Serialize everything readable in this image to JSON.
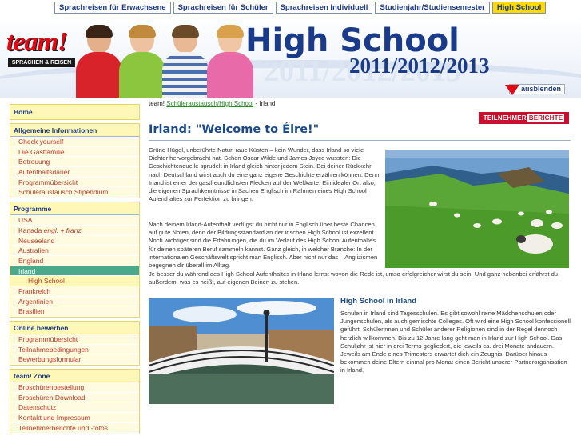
{
  "topnav": [
    {
      "label": "Sprachreisen für Erwachsene"
    },
    {
      "label": "Sprachreisen für Schüler"
    },
    {
      "label": "Sprachreisen Individuell"
    },
    {
      "label": "Studienjahr/Studiensemester"
    },
    {
      "label": "High School"
    }
  ],
  "header": {
    "logo_text": "team!",
    "logo_sub": "SPRACHEN & REISEN",
    "title": "High School",
    "years": "2011/2012/2013",
    "years_bg": "2011/2012/2013",
    "hide_label": "ausblenden"
  },
  "colors": {
    "nav_active": "#ffd900",
    "brand_blue": "#1a3a8a",
    "brand_red": "#e30613",
    "sidebar_bg": "#fff7b8",
    "active_item": "#4aa98a"
  },
  "sidebar": {
    "home": "Home",
    "general": {
      "title": "Allgemeine Informationen",
      "items": [
        "Check yourself",
        "Die Gastfamilie",
        "Betreuung",
        "Aufenthaltsdauer",
        "Programmübersicht",
        "Schüleraustausch Stipendium"
      ]
    },
    "programs": {
      "title": "Programme",
      "items": [
        {
          "label": "USA"
        },
        {
          "label": "Kanada",
          "note": "engl. + franz."
        },
        {
          "label": "Neuseeland"
        },
        {
          "label": "Australien"
        },
        {
          "label": "England"
        },
        {
          "label": "Irland"
        },
        {
          "label": "High School"
        },
        {
          "label": "Frankreich"
        },
        {
          "label": "Argentinien"
        },
        {
          "label": "Brasilien"
        }
      ]
    },
    "apply": {
      "title": "Online bewerben",
      "items": [
        "Programmübersicht",
        "Teilnahmebedingungen",
        "Bewerbungsformular"
      ]
    },
    "zone": {
      "title": "team! Zone",
      "items": [
        "Broschürenbestellung",
        "Broschüren Download",
        "Datenschutz",
        "Kontakt und Impressum",
        "Teilnehmerberichte und -fotos"
      ]
    }
  },
  "content": {
    "crumb_prefix": "team!",
    "crumb_link": "Schüleraustausch/High School",
    "crumb_suffix": "- Irland",
    "tn_label_1": "TEILNEHMER",
    "tn_label_2": "BERICHTE",
    "heading": "Irland: \"Welcome to Éire!\"",
    "para1": "Grüne Hügel, unberührte Natur, raue Küsten – kein Wunder, dass Irland so viele Dichter hervorgebracht hat. Schon Oscar Wilde und James Joyce wussten: Die Geschichtenquelle sprudelt in Irland gleich hinter jedem Stein. Bei deiner Rückkehr nach Deutschland wirst auch du eine ganz eigene Geschichte erzählen können. Denn Irland ist einer der gastfreundlichsten Flecken auf der Weltkarte. Ein idealer Ort also, die eigenen Sprachkenntnisse in Sachen Englisch im Rahmen eines High School Aufenthaltes zur Perfektion zu bringen.",
    "para2": "Nach deinem Irland-Aufenthalt verfügst du nicht nur in Englisch über beste Chancen auf gute Noten, denn der Bildungsstandard an der irischen High School ist exzellent. Noch wichtiger sind die Erfahrungen, die du im Verlauf des High School Aufenthaltes für deinen späteren Beruf sammeln kannst. Ganz gleich, in welcher Branche: In der internationalen Geschäftswelt spricht man Englisch. Aber nicht nur das – Anglizismen begegnen dir überall im Alltag.",
    "para2b": "Je besser du während des High School Aufenthaltes in Irland lernst wovon die Rede ist, umso erfolgreicher wirst du sein. Und ganz nebenbei erfährst du außerdem, was es heißt, auf eigenen Beinen zu stehen.",
    "subheading": "High School in Irland",
    "para3": "Schulen in Irland sind Tagesschulen. Es gibt sowohl reine Mädchenschulen oder Jungenschulen, als auch gemischte Colleges. Oft wird eine High School konfessionell geführt, Schülerinnen und Schüler anderer Religionen sind in der Regel dennoch herzlich willkommen. Bis zu 12 Jahre lang geht man in Irland zur High School. Das Schuljahr ist hier in drei Terms gegliedert, die jeweils ca. drei Monate andauern. Jeweils am Ende eines Trimesters erwartet dich ein Zeugnis. Darüber hinaus bekommen deine Eltern einmal pro Monat einen Bericht unserer Partnerorganisation in Irland."
  }
}
